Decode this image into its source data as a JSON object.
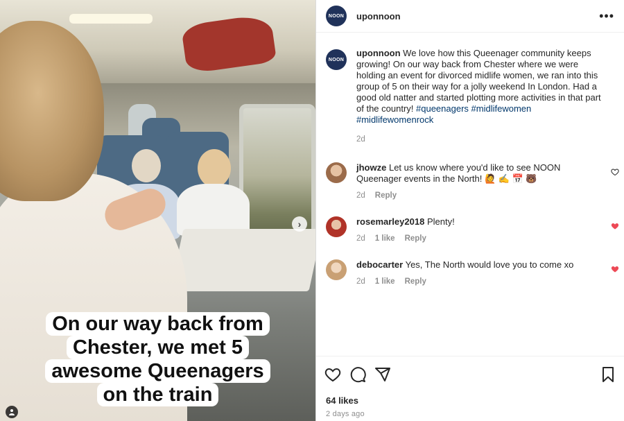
{
  "photo": {
    "caption_lines": [
      "On our way back from",
      "Chester, we met 5",
      "awesome Queenagers",
      "on the train"
    ],
    "next_glyph": "›",
    "tag_glyph": "👤"
  },
  "header": {
    "avatar_text": "NOON",
    "username": "uponnoon",
    "more_glyph": "•••"
  },
  "post": {
    "username": "uponnoon",
    "text": "We love how this Queenager community keeps growing! On our way back from Chester where we were holding an event for divorced midlife women, we ran into this group of 5 on their way for a jolly weekend In London. Had a good old natter and started plotting more activities in that part of the country!",
    "hashtags": "#queenagers #midlifewomen #midlifewomenrock",
    "time": "2d"
  },
  "comments": [
    {
      "username": "jhowze",
      "text": "Let us know where you'd like to see NOON Queenager events in the North! 🙋 ✍️ 📅 🐻",
      "time": "2d",
      "likes": "",
      "reply": "Reply",
      "liked": false,
      "avatar_color": "#9b6b4a"
    },
    {
      "username": "rosemarley2018",
      "text": "Plenty!",
      "time": "2d",
      "likes": "1 like",
      "reply": "Reply",
      "liked": true,
      "avatar_color": "#c0392b"
    },
    {
      "username": "debocarter",
      "text": "Yes, The North would love you to come xo",
      "time": "2d",
      "likes": "1 like",
      "reply": "Reply",
      "liked": true,
      "avatar_color": "#c9a074"
    }
  ],
  "actions": {
    "likes": "64 likes",
    "posted": "2 days ago"
  },
  "colors": {
    "brand": "#20325a",
    "hashtag": "#00376b",
    "heart_red": "#ed4956",
    "muted": "#8e8e8e"
  },
  "icons": [
    "heart-icon",
    "comment-icon",
    "share-icon",
    "bookmark-icon",
    "more-icon",
    "next-arrow-icon",
    "tag-user-icon"
  ]
}
